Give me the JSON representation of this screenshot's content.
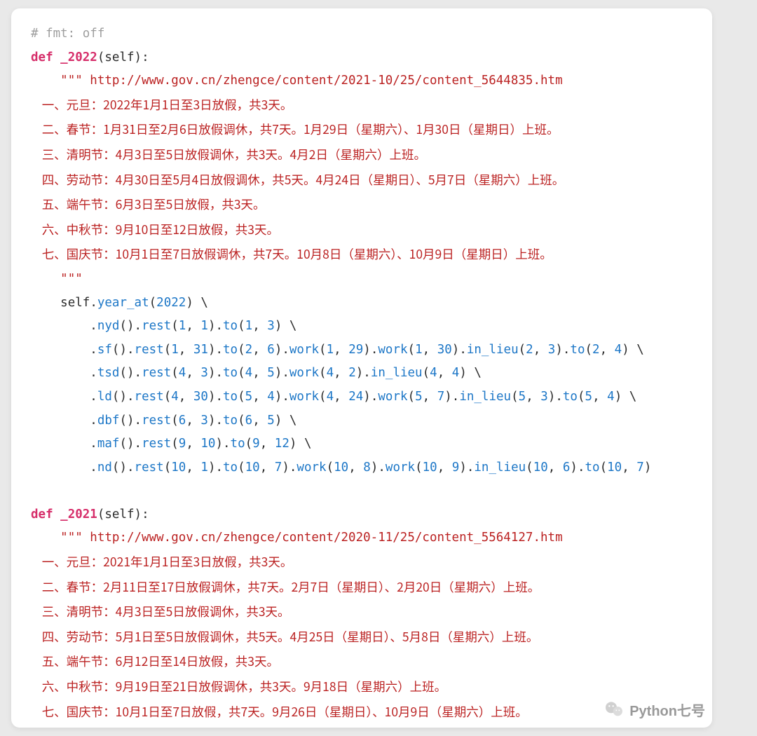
{
  "code": {
    "fmt_off": "# fmt: off",
    "def_kw": "def",
    "self_kw": "self",
    "fn2022": "_2022",
    "fn2021": "_2021",
    "triple": "\"\"\"",
    "url2022": " http://www.gov.cn/zhengce/content/2021-10/25/content_5644835.htm",
    "url2021": " http://www.gov.cn/zhengce/content/2020-11/25/content_5564127.htm",
    "doc2022": [
      "一、元旦：2022年1月1日至3日放假，共3天。",
      "二、春节：1月31日至2月6日放假调休，共7天。1月29日（星期六）、1月30日（星期日）上班。",
      "三、清明节：4月3日至5日放假调休，共3天。4月2日（星期六）上班。",
      "四、劳动节：4月30日至5月4日放假调休，共5天。4月24日（星期日）、5月7日（星期六）上班。",
      "五、端午节：6月3日至5日放假，共3天。",
      "六、中秋节：9月10日至12日放假，共3天。",
      "七、国庆节：10月1日至7日放假调休，共7天。10月8日（星期六）、10月9日（星期日）上班。"
    ],
    "doc2021": [
      "一、元旦：2021年1月1日至3日放假，共3天。",
      "二、春节：2月11日至17日放假调休，共7天。2月7日（星期日）、2月20日（星期六）上班。",
      "三、清明节：4月3日至5日放假调休，共3天。",
      "四、劳动节：5月1日至5日放假调休，共5天。4月25日（星期日）、5月8日（星期六）上班。",
      "五、端午节：6月12日至14日放假，共3天。",
      "六、中秋节：9月19日至21日放假调休，共3天。9月18日（星期六）上班。",
      "七、国庆节：10月1日至7日放假，共7天。9月26日（星期日）、10月9日（星期六）上班。"
    ],
    "m": {
      "year_at": "year_at",
      "nyd": "nyd",
      "sf": "sf",
      "tsd": "tsd",
      "ld": "ld",
      "dbf": "dbf",
      "maf": "maf",
      "nd": "nd",
      "rest": "rest",
      "to": "to",
      "work": "work",
      "in_lieu": "in_lieu"
    },
    "num": {
      "1": "1",
      "2": "2",
      "3": "3",
      "4": "4",
      "5": "5",
      "6": "6",
      "7": "7",
      "8": "8",
      "9": "9",
      "10": "10",
      "12": "12",
      "24": "24",
      "29": "29",
      "30": "30",
      "31": "31",
      "2022": "2022"
    }
  },
  "watermark": "Python七号"
}
